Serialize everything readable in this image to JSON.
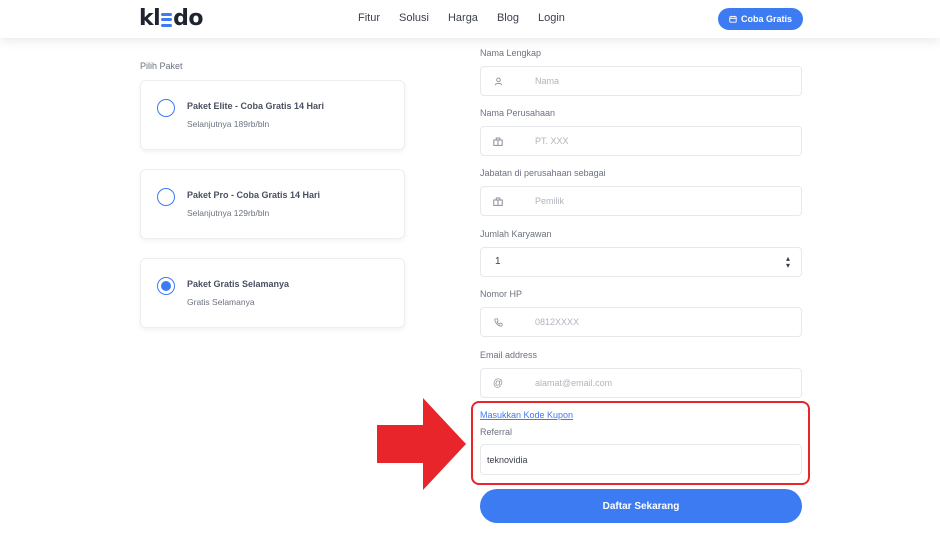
{
  "header": {
    "logo": {
      "pre": "kl",
      "post": "do"
    },
    "nav": [
      "Fitur",
      "Solusi",
      "Harga",
      "Blog",
      "Login"
    ],
    "cta_label": "Coba Gratis"
  },
  "plans": {
    "heading": "Pilih Paket",
    "items": [
      {
        "title": "Paket Elite - Coba Gratis 14 Hari",
        "subtitle": "Selanjutnya 189rb/bln",
        "selected": false
      },
      {
        "title": "Paket Pro - Coba Gratis 14 Hari",
        "subtitle": "Selanjutnya 129rb/bln",
        "selected": false
      },
      {
        "title": "Paket Gratis Selamanya",
        "subtitle": "Gratis Selamanya",
        "selected": true
      }
    ]
  },
  "form": {
    "nama": {
      "label": "Nama Lengkap",
      "placeholder": "Nama",
      "icon": "user-icon"
    },
    "perusahaan": {
      "label": "Nama Perusahaan",
      "placeholder": "PT. XXX",
      "icon": "building-icon"
    },
    "jabatan": {
      "label": "Jabatan di perusahaan sebagai",
      "placeholder": "Pemilik",
      "icon": "building-icon"
    },
    "karyawan": {
      "label": "Jumlah Karyawan",
      "value": "1"
    },
    "hp": {
      "label": "Nomor HP",
      "placeholder": "0812XXXX",
      "icon": "phone-icon"
    },
    "email": {
      "label": "Email address",
      "placeholder": "alamat@email.com",
      "icon": "at-icon"
    },
    "coupon_link": "Masukkan Kode Kupon",
    "referral": {
      "label": "Referral",
      "value": "teknovidia"
    },
    "submit_label": "Daftar Sekarang"
  },
  "colors": {
    "accent": "#3d7bf2",
    "annotation": "#e8252b"
  }
}
